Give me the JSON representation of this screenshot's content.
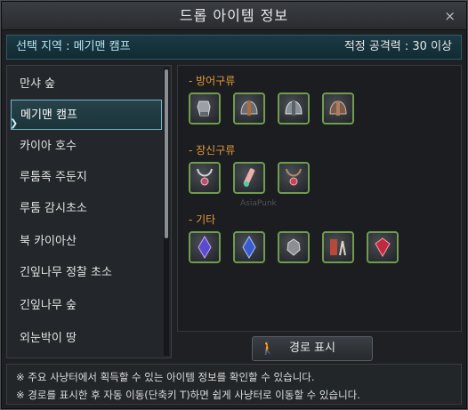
{
  "window": {
    "title": "드롭 아이템 정보",
    "close_symbol": "×"
  },
  "region": {
    "selected": "선택 지역 : 메기맨 캠프",
    "power": "적정 공격력 : 30 이상"
  },
  "sidebar": {
    "items": [
      {
        "label": "만샤 숲"
      },
      {
        "label": "메기맨 캠프"
      },
      {
        "label": "카이아 호수"
      },
      {
        "label": "루툼족 주둔지"
      },
      {
        "label": "루툼 감시초소"
      },
      {
        "label": "북 카이아산"
      },
      {
        "label": "긴잎나무 정찰 초소"
      },
      {
        "label": "긴잎나무 숲"
      },
      {
        "label": "외눈박이 땅"
      }
    ],
    "active_index": 1
  },
  "sections": [
    {
      "label": "- 방어구류",
      "items": [
        {
          "icon": "gloves-icon"
        },
        {
          "icon": "helmet-icon"
        },
        {
          "icon": "helmet-icon"
        },
        {
          "icon": "helmet-icon"
        }
      ]
    },
    {
      "label": "- 장신구류",
      "items": [
        {
          "icon": "necklace-icon"
        },
        {
          "icon": "earring-icon"
        },
        {
          "icon": "necklace-icon"
        }
      ]
    },
    {
      "label": "- 기타",
      "items": [
        {
          "icon": "crystal-icon"
        },
        {
          "icon": "crystal-icon"
        },
        {
          "icon": "ore-icon"
        },
        {
          "icon": "bundle-icon"
        },
        {
          "icon": "gem-icon"
        }
      ]
    }
  ],
  "watermark": "AsiaPunk",
  "route_button": {
    "label": "경로 표시"
  },
  "footer": {
    "lines": [
      "※ 주요 사냥터에서 획득할 수 있는 아이템 정보를 확인할 수 있습니다.",
      "※ 경로를 표시한 후 자동 이동(단축키 T)하면 쉽게 사냥터로 이동할 수 있습니다."
    ]
  },
  "colors": {
    "accent": "#6fb6c8",
    "section_label": "#e39a3a",
    "slot_border": "#6f9c4d"
  }
}
